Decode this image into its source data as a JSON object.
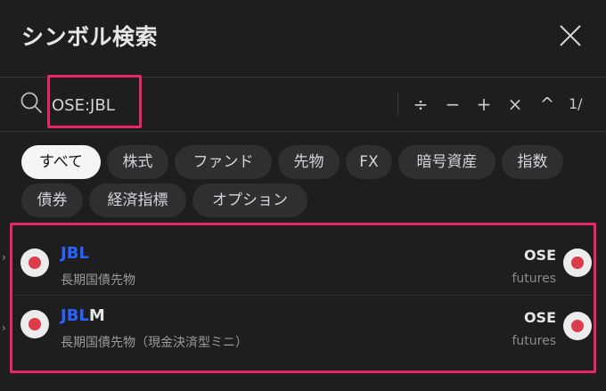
{
  "dialog": {
    "title": "シンボル検索",
    "close_icon": "close-icon"
  },
  "search": {
    "value": "OSE:JBL",
    "icon": "search-icon",
    "tools": [
      "÷",
      "−",
      "+",
      "×",
      "^"
    ],
    "counter": "1/"
  },
  "filters": [
    {
      "label": "すべて",
      "active": true
    },
    {
      "label": "株式",
      "active": false
    },
    {
      "label": "ファンド",
      "active": false
    },
    {
      "label": "先物",
      "active": false
    },
    {
      "label": "FX",
      "active": false
    },
    {
      "label": "暗号資産",
      "active": false
    },
    {
      "label": "指数",
      "active": false
    },
    {
      "label": "債券",
      "active": false
    },
    {
      "label": "経済指標",
      "active": false
    },
    {
      "label": "オプション",
      "active": false
    }
  ],
  "results": [
    {
      "symbol_match": "JBL",
      "symbol_rest": "",
      "description": "長期国債先物",
      "exchange": "OSE",
      "type": "futures"
    },
    {
      "symbol_match": "JBL",
      "symbol_rest": "M",
      "description": "長期国債先物（現金決済型ミニ）",
      "exchange": "OSE",
      "type": "futures"
    }
  ],
  "colors": {
    "background": "#1e1e1e",
    "chip_active": "#f5f5f5",
    "chip": "#2f2f2f",
    "match": "#2962ff",
    "annotation": "#e8246a",
    "flag_red": "#dd3c4a"
  }
}
